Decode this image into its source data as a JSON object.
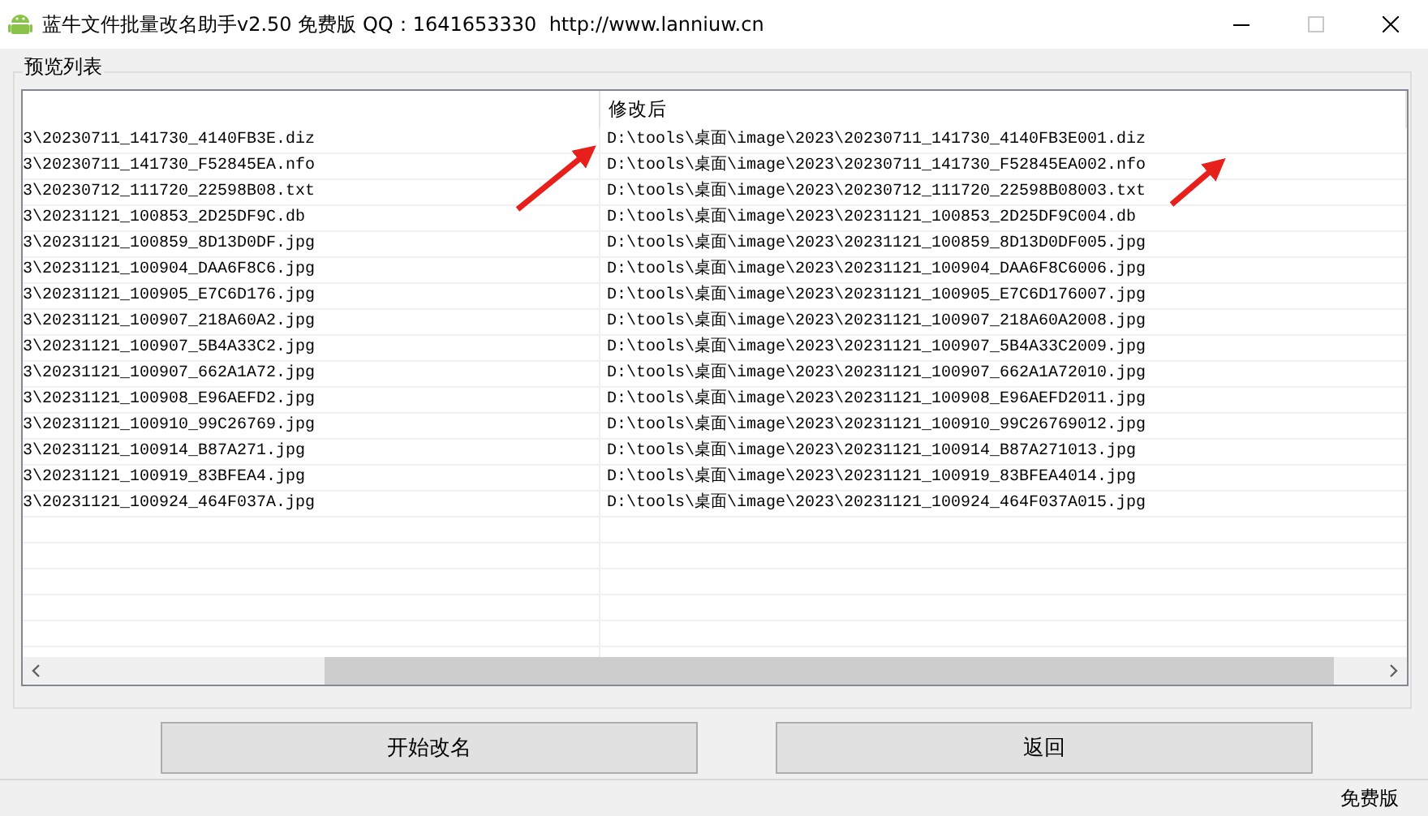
{
  "window": {
    "title": "蓝牛文件批量改名助手v2.50 免费版 QQ：1641653330  http://www.lanniuw.cn",
    "maximize_disabled": true
  },
  "group": {
    "title": "预览列表"
  },
  "table": {
    "heading_2": "修改后",
    "rows": [
      {
        "column_1": "3\\20230711_141730_4140FB3E.diz",
        "column_2": "D:\\tools\\桌面\\image\\2023\\20230711_141730_4140FB3E001.diz"
      },
      {
        "column_1": "3\\20230711_141730_F52845EA.nfo",
        "column_2": "D:\\tools\\桌面\\image\\2023\\20230711_141730_F52845EA002.nfo"
      },
      {
        "column_1": "3\\20230712_111720_22598B08.txt",
        "column_2": "D:\\tools\\桌面\\image\\2023\\20230712_111720_22598B08003.txt"
      },
      {
        "column_1": "3\\20231121_100853_2D25DF9C.db",
        "column_2": "D:\\tools\\桌面\\image\\2023\\20231121_100853_2D25DF9C004.db"
      },
      {
        "column_1": "3\\20231121_100859_8D13D0DF.jpg",
        "column_2": "D:\\tools\\桌面\\image\\2023\\20231121_100859_8D13D0DF005.jpg"
      },
      {
        "column_1": "3\\20231121_100904_DAA6F8C6.jpg",
        "column_2": "D:\\tools\\桌面\\image\\2023\\20231121_100904_DAA6F8C6006.jpg"
      },
      {
        "column_1": "3\\20231121_100905_E7C6D176.jpg",
        "column_2": "D:\\tools\\桌面\\image\\2023\\20231121_100905_E7C6D176007.jpg"
      },
      {
        "column_1": "3\\20231121_100907_218A60A2.jpg",
        "column_2": "D:\\tools\\桌面\\image\\2023\\20231121_100907_218A60A2008.jpg"
      },
      {
        "column_1": "3\\20231121_100907_5B4A33C2.jpg",
        "column_2": "D:\\tools\\桌面\\image\\2023\\20231121_100907_5B4A33C2009.jpg"
      },
      {
        "column_1": "3\\20231121_100907_662A1A72.jpg",
        "column_2": "D:\\tools\\桌面\\image\\2023\\20231121_100907_662A1A72010.jpg"
      },
      {
        "column_1": "3\\20231121_100908_E96AEFD2.jpg",
        "column_2": "D:\\tools\\桌面\\image\\2023\\20231121_100908_E96AEFD2011.jpg"
      },
      {
        "column_1": "3\\20231121_100910_99C26769.jpg",
        "column_2": "D:\\tools\\桌面\\image\\2023\\20231121_100910_99C26769012.jpg"
      },
      {
        "column_1": "3\\20231121_100914_B87A271.jpg",
        "column_2": "D:\\tools\\桌面\\image\\2023\\20231121_100914_B87A271013.jpg"
      },
      {
        "column_1": "3\\20231121_100919_83BFEA4.jpg",
        "column_2": "D:\\tools\\桌面\\image\\2023\\20231121_100919_83BFEA4014.jpg"
      },
      {
        "column_1": "3\\20231121_100924_464F037A.jpg",
        "column_2": "D:\\tools\\桌面\\image\\2023\\20231121_100924_464F037A015.jpg"
      }
    ]
  },
  "buttons": [
    "开始改名",
    "返回"
  ],
  "status_bar": {
    "text": "免费版"
  }
}
